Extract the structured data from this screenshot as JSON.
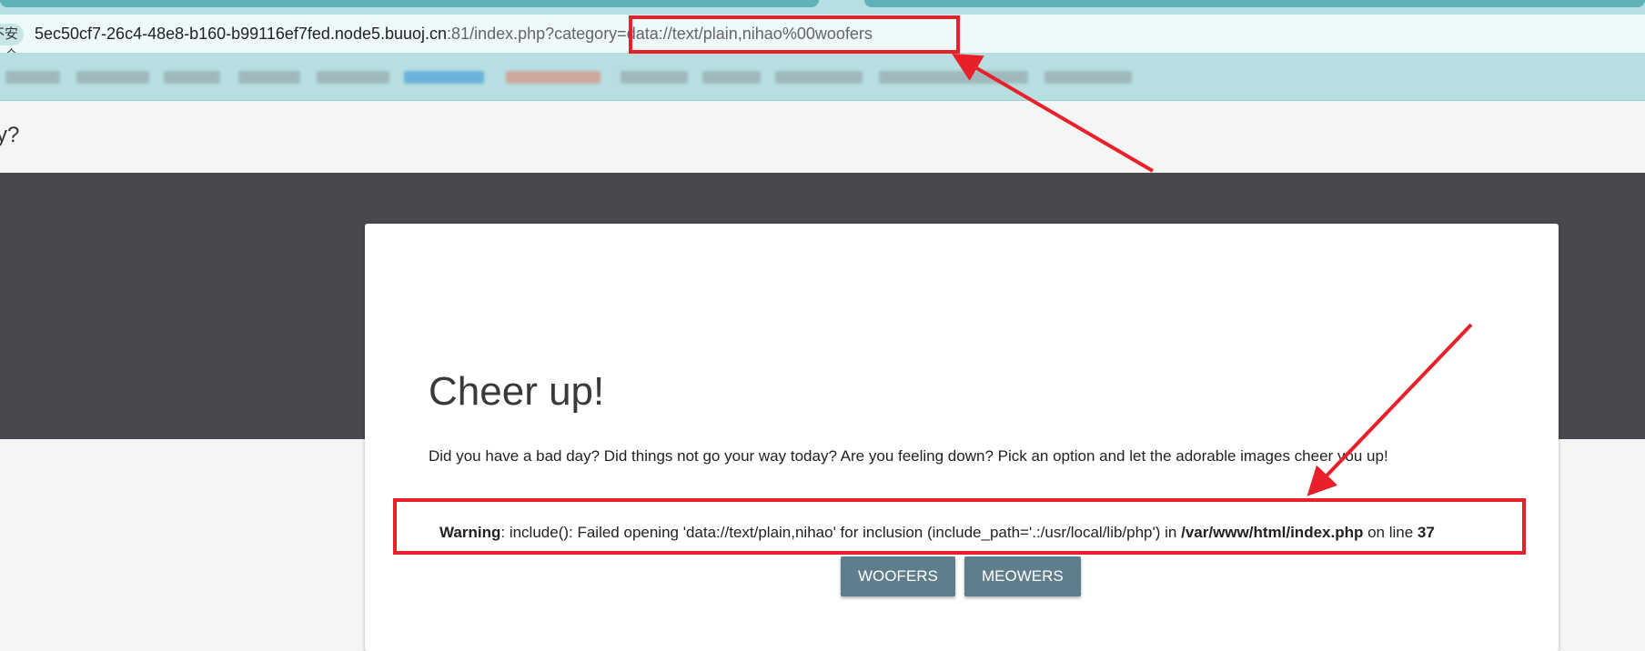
{
  "browser": {
    "security_label": "不安全",
    "url_host": "5ec50cf7-26c4-48e8-b160-b99116ef7fed.node5.buuoj.cn",
    "url_rest": ":81/index.php?category=data://text/plain,nihao%00woofers"
  },
  "page": {
    "question_fragment": "y?",
    "card": {
      "title": "Cheer up!",
      "description": "Did you have a bad day? Did things not go your way today? Are you feeling down? Pick an option and let the adorable images cheer you up!",
      "warning": {
        "label": "Warning",
        "message": ": include(): Failed opening 'data://text/plain,nihao' for inclusion (include_path='.:/usr/local/lib/php') in ",
        "file": "/var/www/html/index.php",
        "on_line": " on line ",
        "line": "37"
      },
      "buttons": {
        "woofers": "WOOFERS",
        "meowers": "MEOWERS"
      }
    }
  },
  "colors": {
    "annotation": "#e8202a",
    "button": "#607d8b",
    "hero": "#48494e"
  }
}
